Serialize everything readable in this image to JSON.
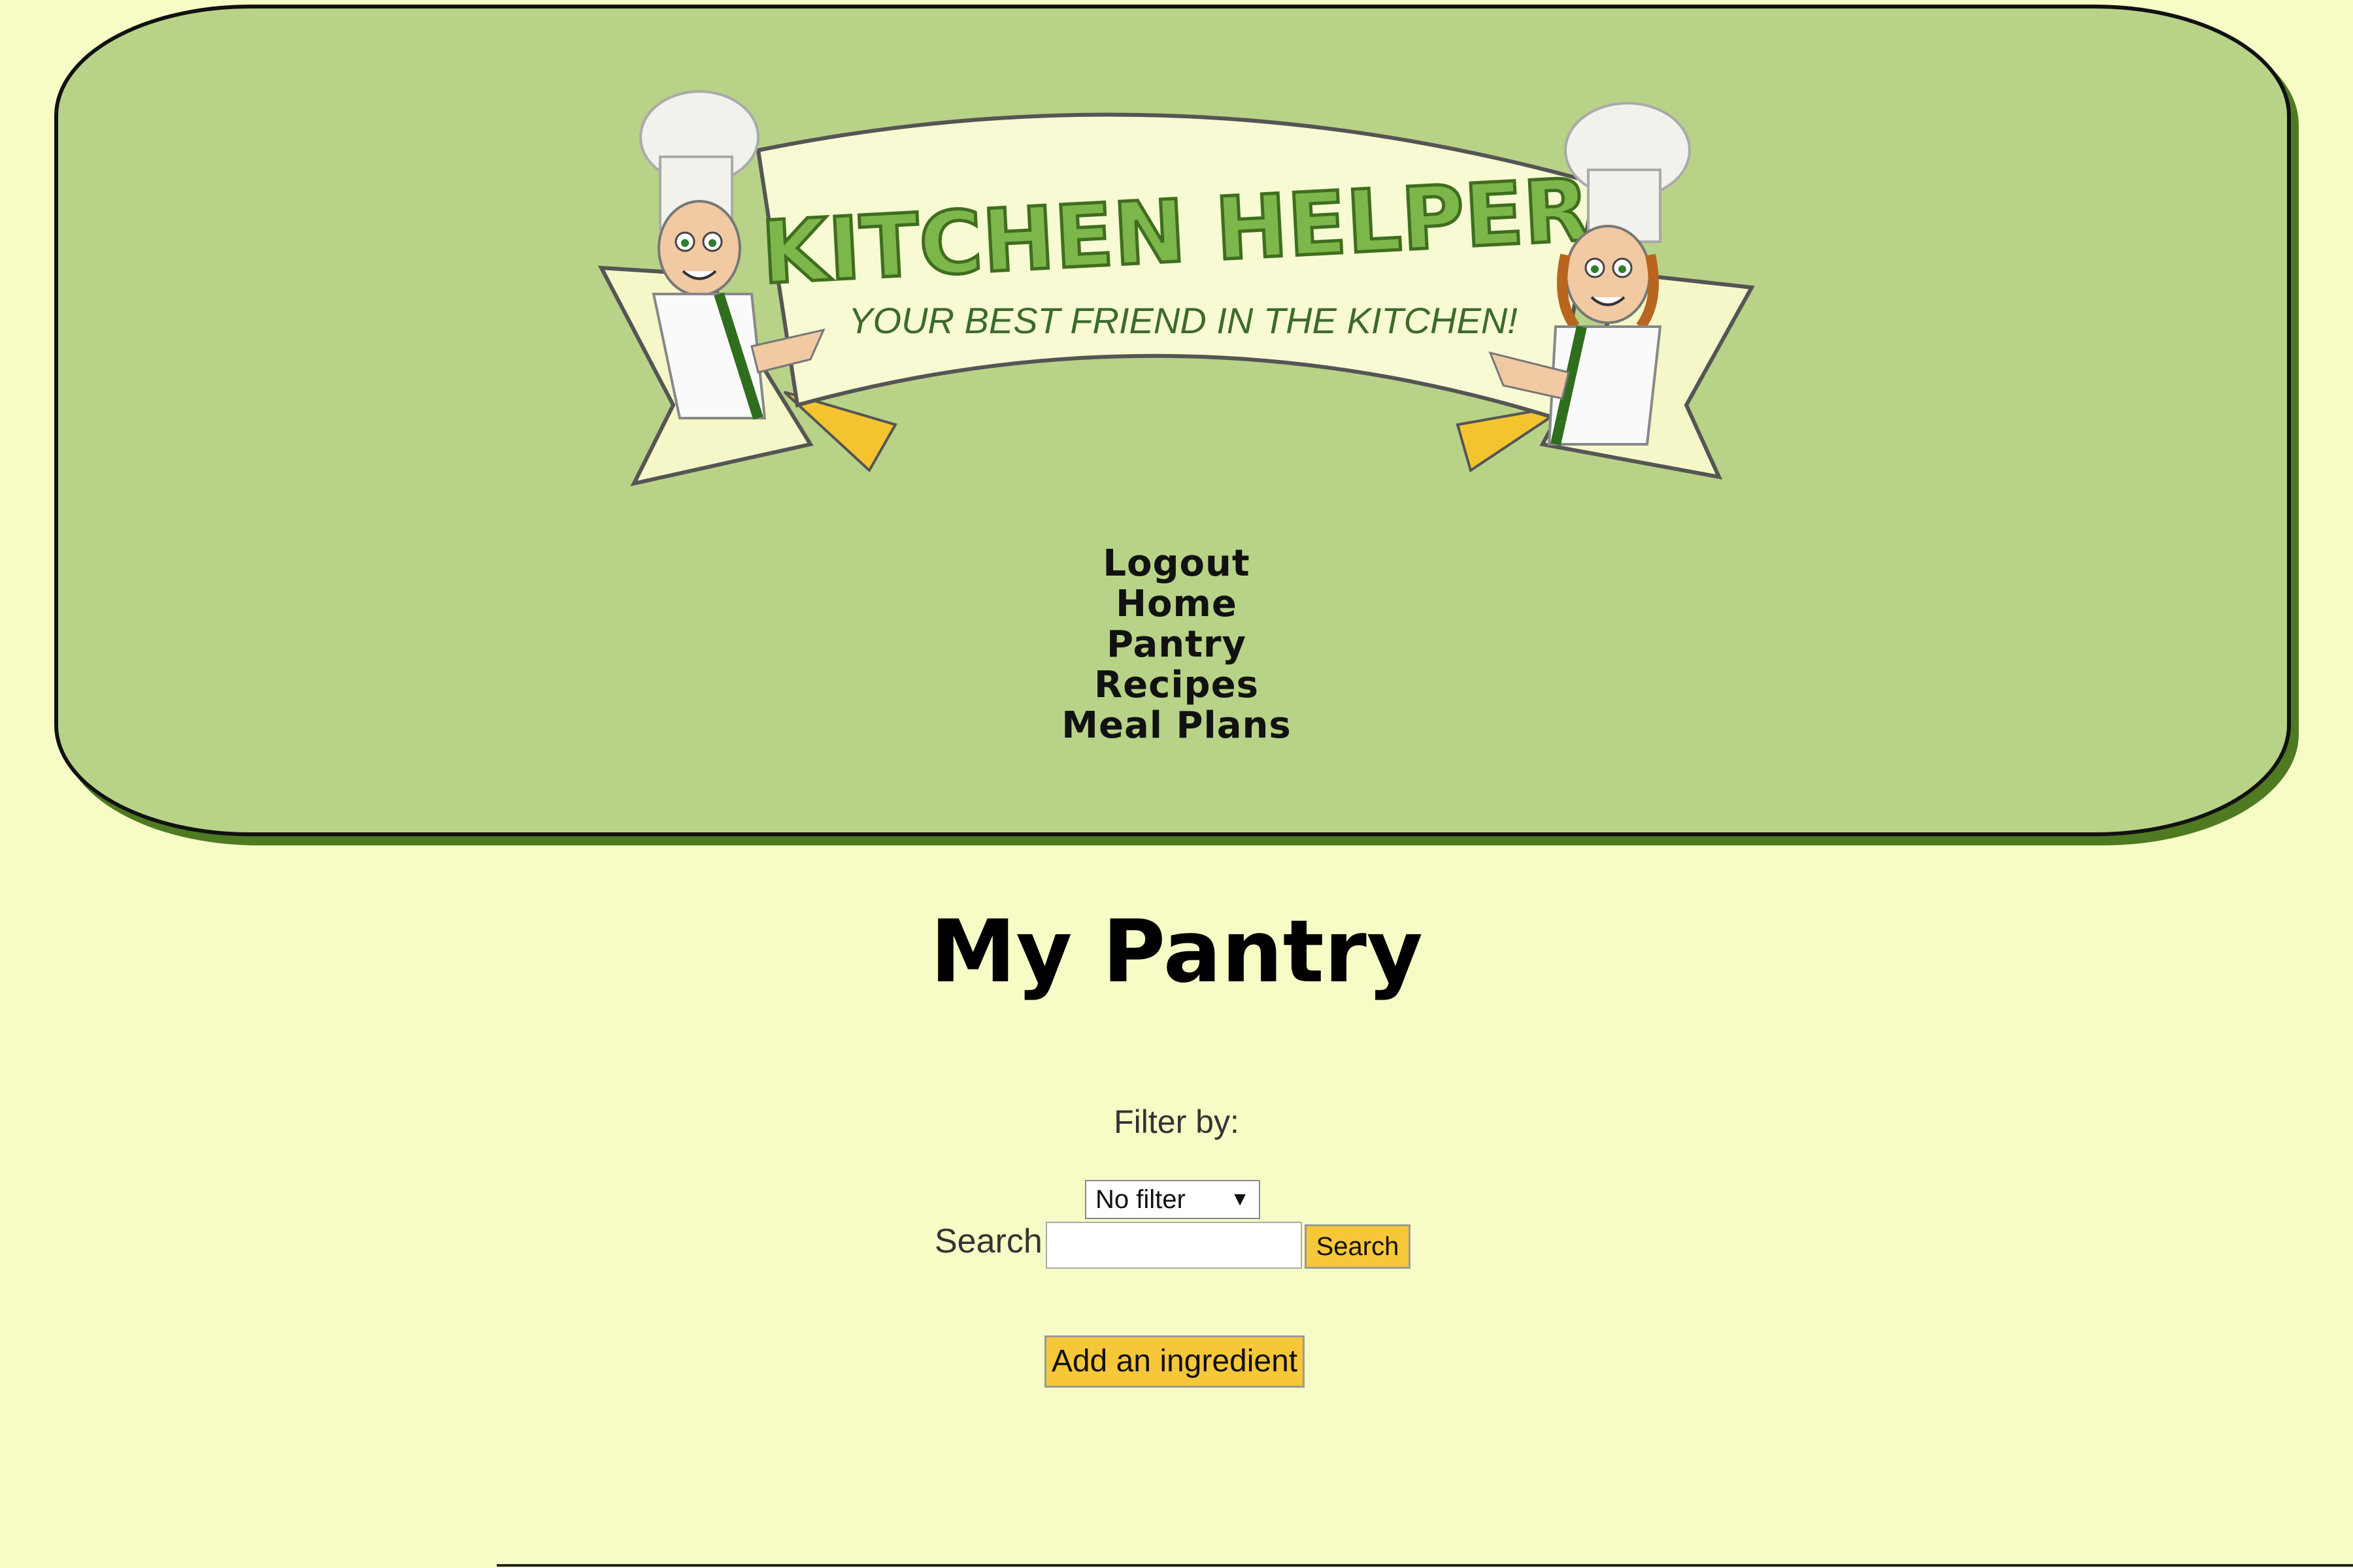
{
  "header": {
    "logo_title": "KITCHEN HELPER",
    "logo_tagline": "YOUR BEST FRIEND IN THE KITCHEN!"
  },
  "nav": {
    "items": [
      {
        "label": "Logout"
      },
      {
        "label": "Home"
      },
      {
        "label": "Pantry"
      },
      {
        "label": "Recipes"
      },
      {
        "label": "Meal Plans"
      }
    ]
  },
  "main": {
    "title": "My Pantry",
    "filter_label": "Filter by:",
    "filter_select_value": "No filter",
    "search_label": "Search",
    "search_value": "",
    "search_button": "Search",
    "add_button": "Add an ingredient"
  },
  "colors": {
    "page_bg": "#f7fcc6",
    "header_bg": "#b8d288",
    "button_bg": "#f7c73a",
    "logo_green": "#6fa83c"
  }
}
